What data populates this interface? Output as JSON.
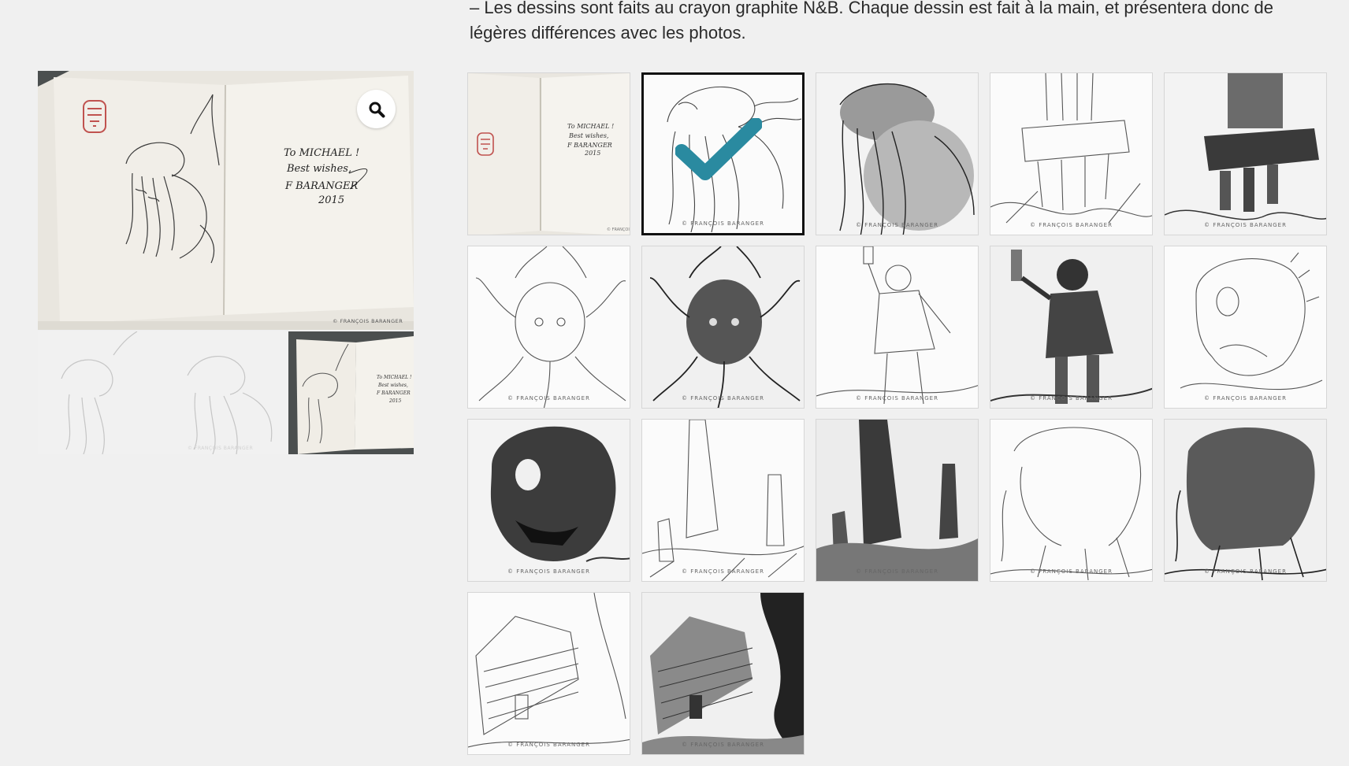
{
  "description": {
    "text": "– Les dessins sont faits au crayon graphite N&B. Chaque dessin est fait à la main, et présentera donc de légères différences avec les photos."
  },
  "gallery": {
    "zoom_icon": "magnifier-icon",
    "main_image": {
      "dedication": [
        "To MICHAEL !",
        "Best wishes,",
        "F BARANGER",
        "2015"
      ],
      "credit": "© FRANÇOIS BARANGER"
    },
    "strip_credit": "© FRANÇOIS BARANGER"
  },
  "thumbnails": {
    "credit": "© FRANÇOIS BARANGER",
    "selected_index": 1,
    "selected_icon": "checkmark-icon",
    "accent_color": "#2a8aa0",
    "items": [
      {
        "subject": "signed-book"
      },
      {
        "subject": "cthulhu-sketch-light"
      },
      {
        "subject": "cthulhu-sketch-dark"
      },
      {
        "subject": "ruined-tower-light"
      },
      {
        "subject": "ruined-tower-dark"
      },
      {
        "subject": "tentacle-creature-light"
      },
      {
        "subject": "tentacle-creature-dark"
      },
      {
        "subject": "explorer-lantern-light"
      },
      {
        "subject": "explorer-lantern-dark"
      },
      {
        "subject": "deep-one-light"
      },
      {
        "subject": "deep-one-dark"
      },
      {
        "subject": "monoliths-light"
      },
      {
        "subject": "monoliths-dark"
      },
      {
        "subject": "giant-creature-light"
      },
      {
        "subject": "giant-creature-dark"
      },
      {
        "subject": "old-house-light"
      },
      {
        "subject": "old-house-dark"
      }
    ]
  }
}
